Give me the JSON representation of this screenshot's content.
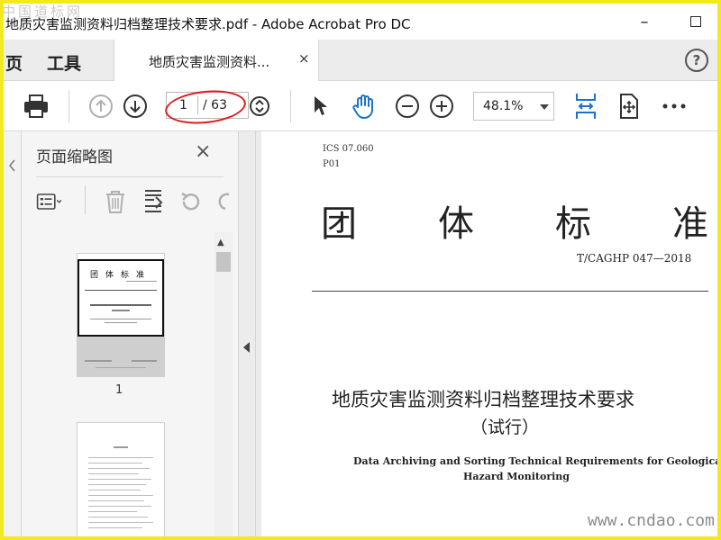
{
  "window": {
    "title": "地质灾害监测资料归档整理技术要求.pdf - Adobe Acrobat Pro DC",
    "minimize_label": "–"
  },
  "watermarks": {
    "top_left": "中国道标网",
    "bottom_right": "www.cndao.com"
  },
  "nav_tabs": {
    "home": "页",
    "tools": "工具"
  },
  "doc_tab": {
    "label": "地质灾害监测资料...",
    "close": "×"
  },
  "help_label": "?",
  "toolbar": {
    "current_page": "1",
    "total_pages": "/ 63",
    "zoom": "48.1%",
    "highlight_color": "#e01b1b",
    "accent_color": "#1a73c8"
  },
  "thumb_panel": {
    "title": "页面缩略图",
    "close": "×",
    "thumb1_page_label": "1",
    "thumb1_heading": "团体标准"
  },
  "document": {
    "ics": "ICS 07.060",
    "p01": "P01",
    "big_title_chars": [
      "团",
      "体",
      "标",
      "准"
    ],
    "standard_no": "T/CAGHP 047—2018",
    "cn_title": "地质灾害监测资料归档整理技术要求",
    "cn_subtitle": "（试行）",
    "en_title_line1": "Data Archiving and Sorting Technical Requirements for Geological",
    "en_title_line2": "Hazard Monitoring"
  }
}
